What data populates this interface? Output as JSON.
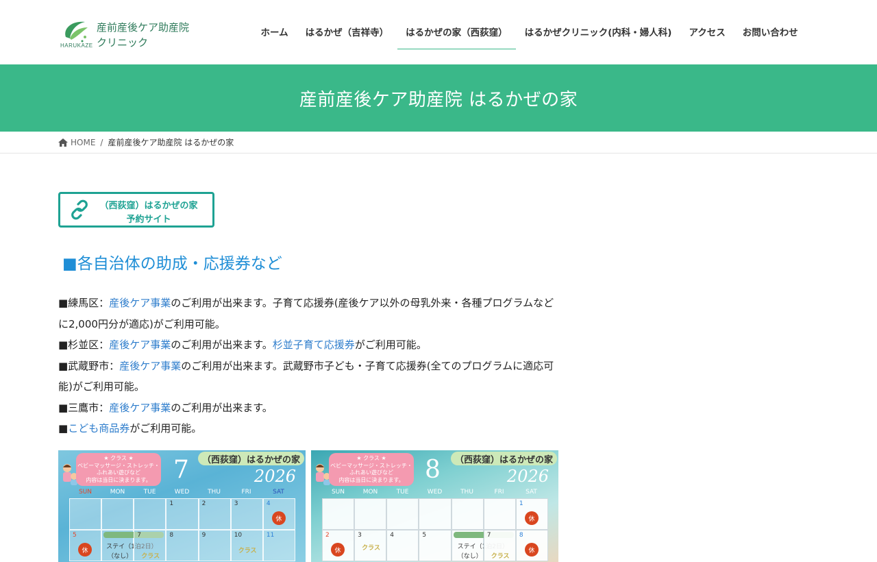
{
  "header": {
    "logo": {
      "line1": "産前産後ケア助産院",
      "line2": "クリニック",
      "brand_en": "HARUKAZE"
    },
    "nav": [
      {
        "label": "ホーム",
        "active": false
      },
      {
        "label": "はるかぜ（吉祥寺）",
        "active": false
      },
      {
        "label": "はるかぜの家（西荻窪）",
        "active": true
      },
      {
        "label": "はるかぜクリニック(内科・婦人科)",
        "active": false
      },
      {
        "label": "アクセス",
        "active": false
      },
      {
        "label": "お問い合わせ",
        "active": false
      }
    ]
  },
  "page_title": "産前産後ケア助産院 はるかぜの家",
  "breadcrumb": {
    "home": "HOME",
    "separator": "/",
    "current": "産前産後ケア助産院 はるかぜの家"
  },
  "reserve_button": {
    "line1": "（西荻窪）はるかぜの家",
    "line2": "予約サイト",
    "icon": "link-icon"
  },
  "section_heading": "■各自治体の助成・応援券など",
  "subsidies": {
    "nerima": {
      "prefix": "■練馬区：",
      "link": "産後ケア事業",
      "suffix": "のご利用が出来ます。子育て応援券(産後ケア以外の母乳外来・各種プログラムなどに2,000円分が適応)がご利用可能。"
    },
    "suginami": {
      "prefix": "■杉並区：",
      "link1": "産後ケア事業",
      "middle": "のご利用が出来ます。",
      "link2": "杉並子育て応援券",
      "suffix": "がご利用可能。"
    },
    "musashino": {
      "prefix": "■武蔵野市：",
      "link": "産後ケア事業",
      "suffix": "のご利用が出来ます。武蔵野市子ども・子育て応援券(全てのプログラムに適応可能)がご利用可能。"
    },
    "mitaka": {
      "prefix": "■三鷹市：",
      "link": "産後ケア事業",
      "suffix": "のご利用が出来ます。"
    },
    "kodomo": {
      "prefix": "■",
      "link": "こども商品券",
      "suffix": "がご利用可能。"
    }
  },
  "calendar_common": {
    "class_box": [
      "★ クラス ★",
      "ベビーマッサージ・ストレッチ・",
      "ふれあい遊びなど",
      "内容は当日に決まります。"
    ],
    "house_label": "（西荻窪）はるかぜの家",
    "year": "2026",
    "weekdays": [
      "SUN",
      "MON",
      "TUE",
      "WED",
      "THU",
      "FRI",
      "SAT"
    ],
    "closed_label": "休",
    "class_label": "クラス",
    "stay_label": "ステイ（1泊2日）",
    "none_label": "（なし）"
  },
  "calendars": [
    {
      "month": "7",
      "week1": [
        "",
        "",
        "",
        "1",
        "2",
        "3",
        "4"
      ],
      "week2": [
        "5",
        "6",
        "7",
        "8",
        "9",
        "10",
        "11"
      ]
    },
    {
      "month": "8",
      "week1": [
        "",
        "",
        "",
        "",
        "",
        "",
        "1"
      ],
      "week2": [
        "2",
        "3",
        "4",
        "5",
        "6",
        "7",
        "8"
      ]
    }
  ],
  "colors": {
    "brand_green": "#3ab889",
    "heading_blue": "#1f8ed6",
    "link_blue": "#2e7dcc",
    "reserve_teal": "#1ea293"
  }
}
